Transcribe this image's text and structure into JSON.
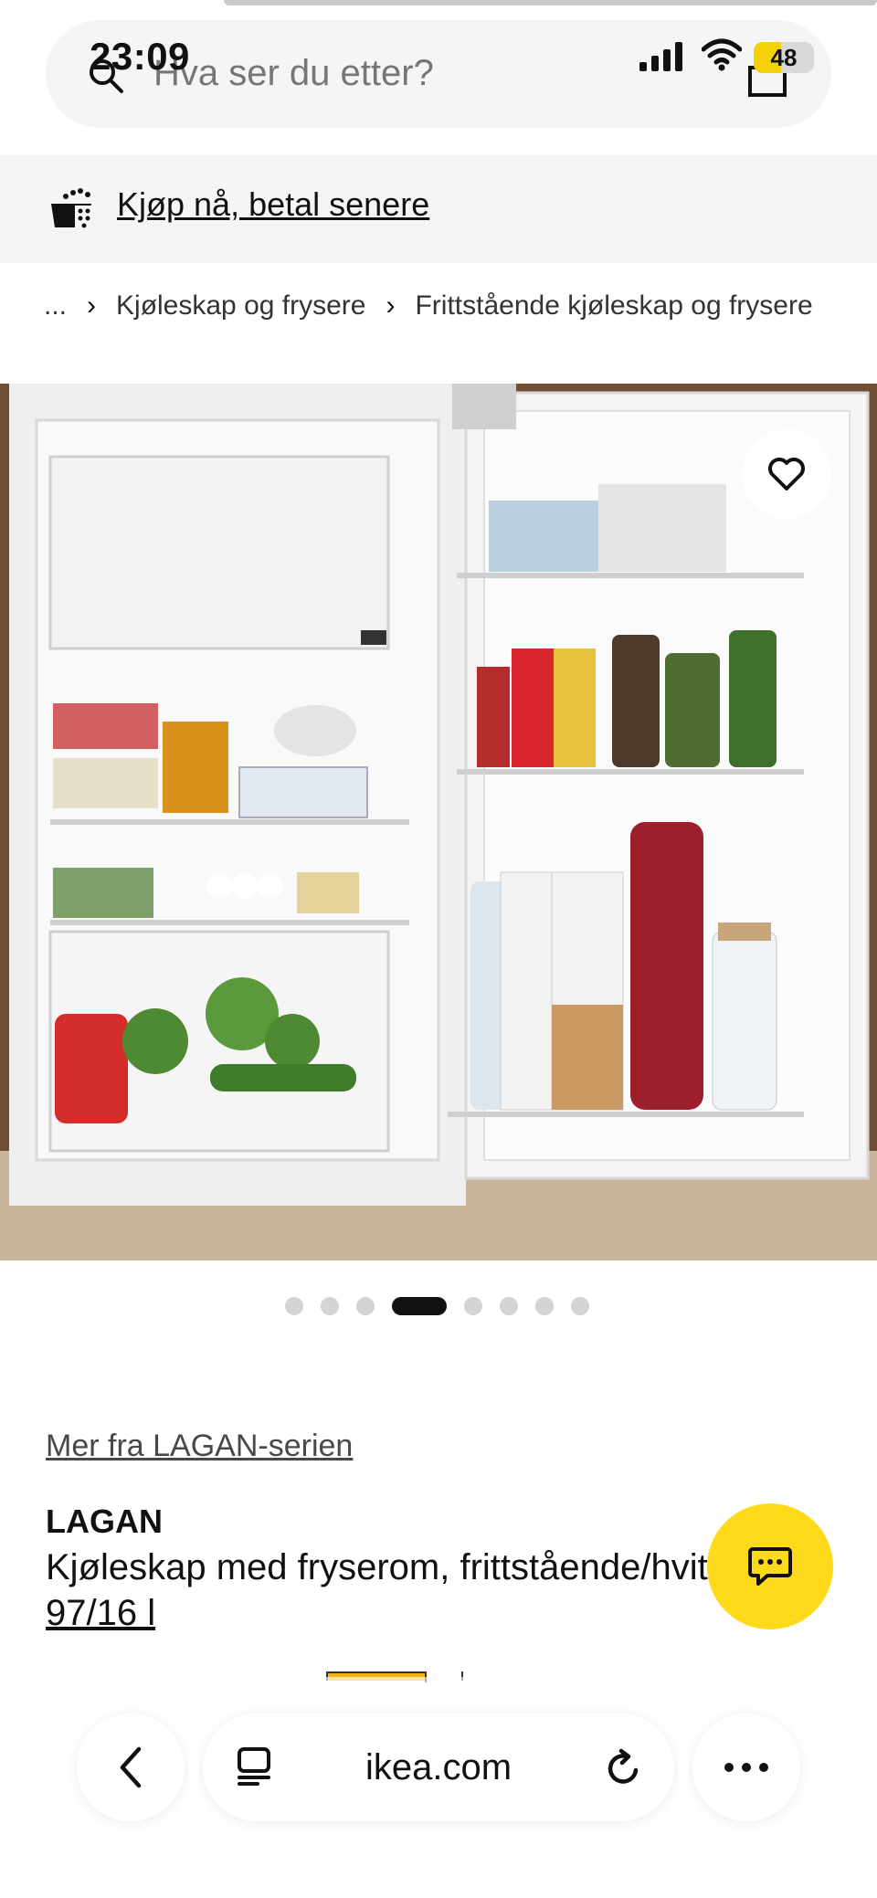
{
  "status_bar": {
    "time": "23:09",
    "battery": "48"
  },
  "search": {
    "placeholder": "Hva ser du etter?"
  },
  "banner": {
    "text": "Kjøp nå, betal senere"
  },
  "breadcrumb": {
    "ellipsis": "...",
    "items": [
      "Kjøleskap og frysere",
      "Frittstående kjøleskap og frysere"
    ]
  },
  "gallery": {
    "total_images": 8,
    "active_index": 4
  },
  "product": {
    "series_link": "Mer fra LAGAN-serien",
    "name": "LAGAN",
    "description": "Kjøleskap med fryserom, frittstående/hvit",
    "volume": "97/16 l"
  },
  "browser": {
    "url": "ikea.com"
  },
  "colors": {
    "accent_yellow": "#ffda1a",
    "battery_yellow": "#f5d10a",
    "text": "#111111"
  }
}
